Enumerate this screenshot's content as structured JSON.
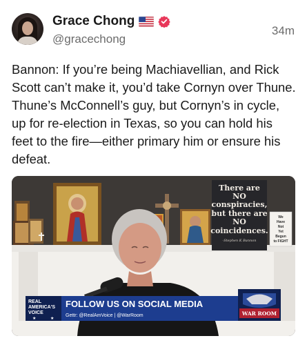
{
  "author": {
    "name": "Grace Chong",
    "handle": "@gracechong",
    "flag_icon": "us-flag-icon",
    "verified_icon": "verified-badge-icon"
  },
  "timestamp": "34m",
  "body": "Bannon: If you’re being Machiavellian, and Rick Scott can’t make it, you’d take Cornyn over Thune. Thune’s McConnell’s guy, but Cornyn’s in cycle, up for re-election in Texas, so you can hold his feet to the fire—either primary him or ensure his defeat.",
  "media": {
    "sign": {
      "line1": "There are",
      "line2": "NO",
      "line3": "conspiracies,",
      "line4": "but there are",
      "line5": "NO",
      "line6": "coincidences.",
      "attribution": "-Stephen K Bannon"
    },
    "card": {
      "line1": "We",
      "line2": "Have",
      "line3": "Not",
      "line4": "Yet",
      "line5": "Begun",
      "line6": "to FIGHT"
    },
    "banner": {
      "logo_line1": "REAL",
      "logo_line2": "AMERICA'S",
      "logo_line3": "VOICE",
      "headline": "FOLLOW US ON SOCIAL MEDIA",
      "subline": "Gettr: @RealAmVoice | @WarRoom",
      "brand": "WAR ROOM"
    }
  },
  "colors": {
    "verified": "#e8385a",
    "banner_blue": "#1d3d8f",
    "banner_navy": "#0f2050"
  }
}
